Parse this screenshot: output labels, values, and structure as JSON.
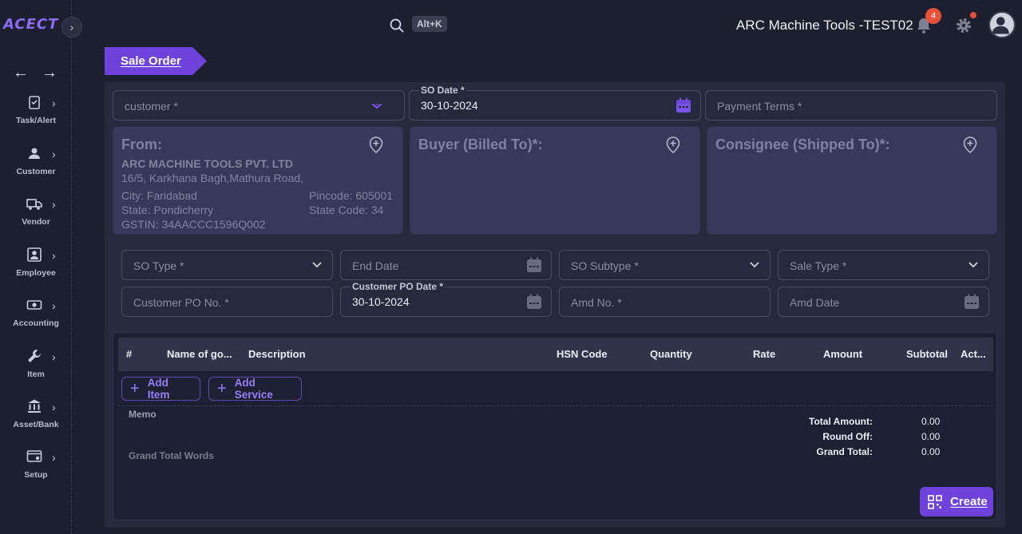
{
  "brand": {
    "logo": "ACECT"
  },
  "topbar": {
    "shortcut": "Alt+K",
    "company": "ARC Machine Tools -TEST02",
    "notifications_count": "4"
  },
  "sidebar": {
    "items": [
      {
        "label": "Task/Alert",
        "icon": "task-icon"
      },
      {
        "label": "Customer",
        "icon": "customer-icon"
      },
      {
        "label": "Vendor",
        "icon": "truck-icon"
      },
      {
        "label": "Employee",
        "icon": "employee-icon"
      },
      {
        "label": "Accounting",
        "icon": "money-icon"
      },
      {
        "label": "Item",
        "icon": "wrench-icon"
      },
      {
        "label": "Asset/Bank",
        "icon": "bank-icon"
      },
      {
        "label": "Setup",
        "icon": "setup-icon"
      }
    ]
  },
  "page": {
    "tab_label": "Sale Order"
  },
  "form": {
    "customer_placeholder": "customer *",
    "so_date_label": "SO Date *",
    "so_date_value": "30-10-2024",
    "payment_terms_placeholder": "Payment Terms *",
    "so_type_placeholder": "SO Type *",
    "end_date_placeholder": "End Date",
    "so_subtype_placeholder": "SO Subtype *",
    "sale_type_placeholder": "Sale Type *",
    "customer_po_no_placeholder": "Customer PO No. *",
    "customer_po_date_label": "Customer PO Date *",
    "customer_po_date_value": "30-10-2024",
    "amd_no_placeholder": "Amd No. *",
    "amd_date_placeholder": "Amd Date"
  },
  "from": {
    "heading": "From:",
    "company": "ARC MACHINE TOOLS PVT. LTD",
    "address": "16/5, Karkhana Bagh,Mathura Road,",
    "city": "City: Faridabad",
    "pincode": "Pincode: 605001",
    "state": "State: Pondicherry",
    "state_code": "State Code: 34",
    "gstin": "GSTIN: 34AACCC1596Q002"
  },
  "buyer": {
    "heading": "Buyer (Billed To)*:"
  },
  "consignee": {
    "heading": "Consignee (Shipped To)*:"
  },
  "table": {
    "columns": [
      "#",
      "Name of go...",
      "Description",
      "HSN Code",
      "Quantity",
      "Rate",
      "Amount",
      "Subtotal",
      "Act..."
    ],
    "add_item": "Add Item",
    "add_service": "Add Service",
    "memo_label": "Memo",
    "grand_total_words_label": "Grand Total Words"
  },
  "totals": {
    "total_amount_label": "Total Amount:",
    "total_amount": "0.00",
    "round_off_label": "Round Off:",
    "round_off": "0.00",
    "grand_total_label": "Grand Total:",
    "grand_total": "0.00"
  },
  "actions": {
    "create": "Create"
  },
  "colors": {
    "accent": "#6f42dc",
    "badge": "#e8503a",
    "panel": "#262a3d"
  }
}
